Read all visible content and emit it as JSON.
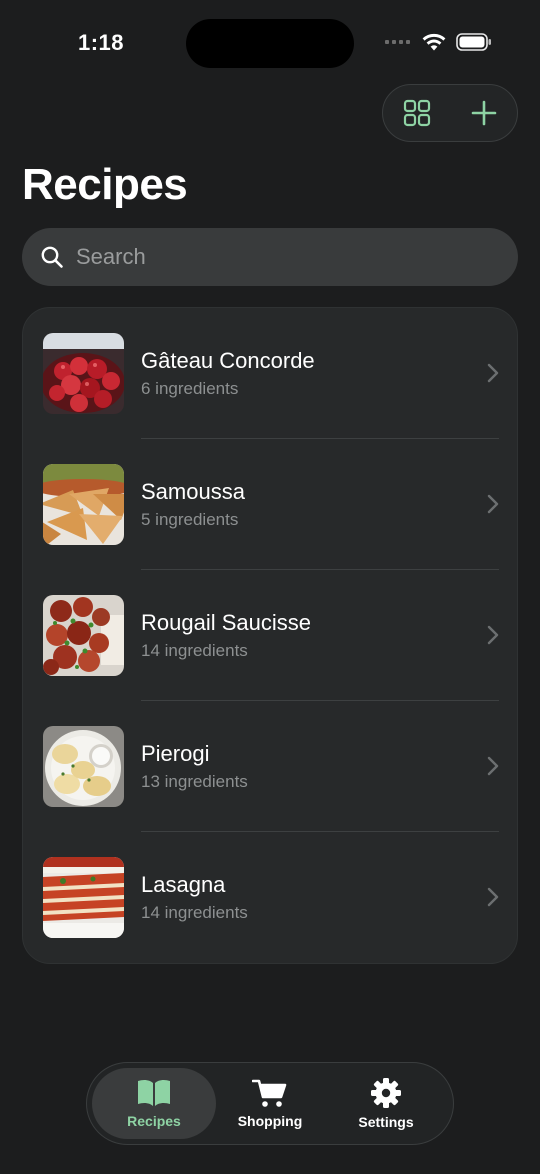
{
  "status_bar": {
    "time": "1:18"
  },
  "header": {
    "grid_icon": "grid-view-icon",
    "add_icon": "plus-icon",
    "title": "Recipes"
  },
  "search": {
    "placeholder": "Search",
    "value": ""
  },
  "recipes": [
    {
      "name": "Gâteau Concorde",
      "subtitle": "6 ingredients"
    },
    {
      "name": "Samoussa",
      "subtitle": "5 ingredients"
    },
    {
      "name": "Rougail Saucisse",
      "subtitle": "14 ingredients"
    },
    {
      "name": "Pierogi",
      "subtitle": "13 ingredients"
    },
    {
      "name": "Lasagna",
      "subtitle": "14 ingredients"
    }
  ],
  "tabs": [
    {
      "label": "Recipes",
      "icon": "book-icon",
      "active": true
    },
    {
      "label": "Shopping",
      "icon": "cart-icon",
      "active": false
    },
    {
      "label": "Settings",
      "icon": "gear-icon",
      "active": false
    }
  ],
  "colors": {
    "accent": "#8ed3a4",
    "background": "#1c1d1e",
    "card": "#27292a"
  }
}
